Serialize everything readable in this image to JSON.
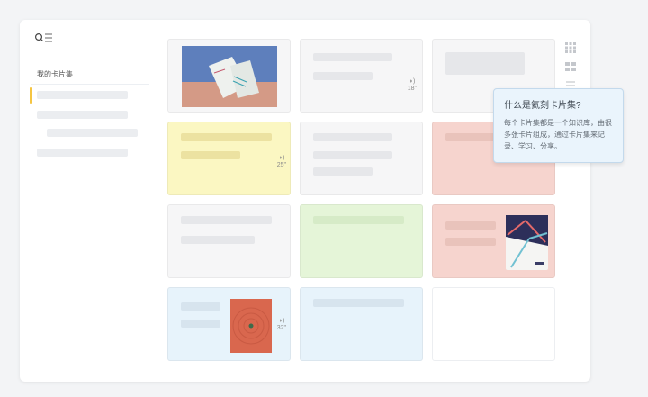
{
  "sidebar": {
    "title": "我的卡片集"
  },
  "cards": {
    "audio_1": "18''",
    "audio_2": "25''",
    "audio_3": "32''"
  },
  "tooltip": {
    "title": "什么是氦刻卡片集?",
    "body": "每个卡片集都是一个知识库，由很多张卡片组成，通过卡片集来记录、学习、分享。"
  },
  "colors": {
    "accent": "#f5c542",
    "tile_gray": "#f6f6f7",
    "tile_yellow": "#fbf7c2",
    "tile_pink": "#f6d4ce",
    "tile_green": "#e5f5d8",
    "tile_blue": "#e7f3fb",
    "tooltip_bg": "#eaf4fc"
  },
  "icons": [
    "search-list-icon",
    "grid-view-icon",
    "card-view-icon",
    "list-view-icon",
    "audio-icon"
  ]
}
